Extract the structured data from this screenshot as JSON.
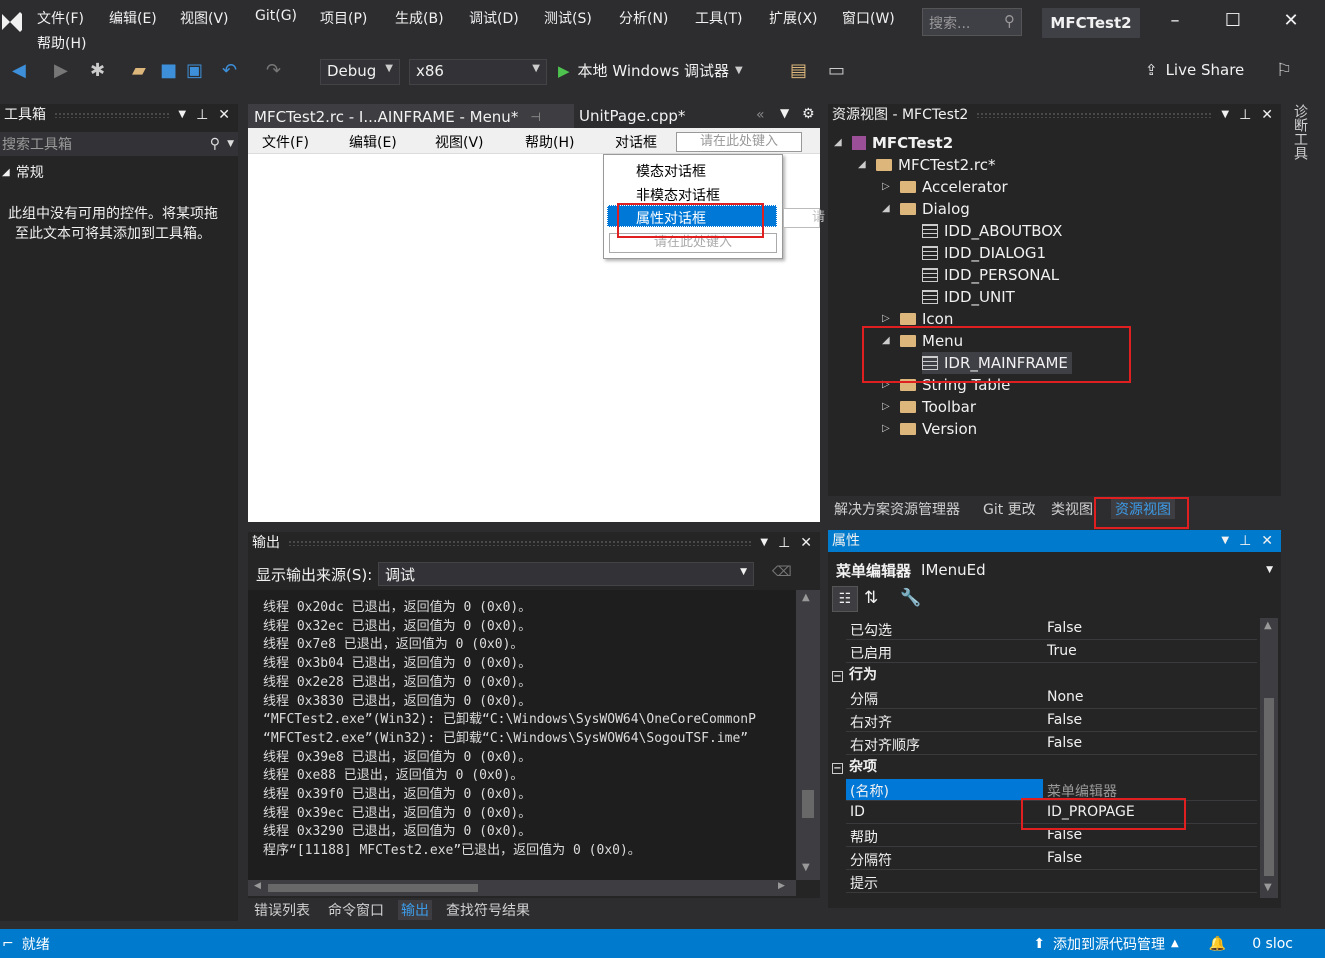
{
  "menu": {
    "items": [
      "文件(F)",
      "编辑(E)",
      "视图(V)",
      "Git(G)",
      "项目(P)",
      "生成(B)",
      "调试(D)",
      "测试(S)",
      "分析(N)",
      "工具(T)",
      "扩展(X)",
      "窗口(W)"
    ],
    "help": "帮助(H)",
    "search_placeholder": "搜索...",
    "solution_name": "MFCTest2"
  },
  "toolbar": {
    "config": "Debug",
    "platform": "x86",
    "debug_target": "本地 Windows 调试器",
    "live_share": "Live Share"
  },
  "side_vertical_tab": "诊断工具",
  "toolbox": {
    "title": "工具箱",
    "search_placeholder": "搜索工具箱",
    "group": "常规",
    "empty_message": "此组中没有可用的控件。将某项拖至此文本可将其添加到工具箱。"
  },
  "editor": {
    "tabs": [
      {
        "label": "MFCTest2.rc - I...AINFRAME - Menu*",
        "active": true
      },
      {
        "label": "UnitPage.cpp*",
        "active": false
      }
    ],
    "menubar": [
      "文件(F)",
      "编辑(E)",
      "视图(V)",
      "帮助(H)",
      "对话框"
    ],
    "type_here": "请在此处键入",
    "dropdown": [
      "模态对话框",
      "非模态对话框",
      "属性对话框"
    ],
    "dropdown_type_here": "请在此处键入",
    "side_type_here": "请"
  },
  "resource_view": {
    "title": "资源视图 - MFCTest2",
    "tree": [
      {
        "label": "MFCTest2",
        "level": 0,
        "bold": true,
        "kind": "project"
      },
      {
        "label": "MFCTest2.rc*",
        "level": 1,
        "kind": "rc"
      },
      {
        "label": "Accelerator",
        "level": 2,
        "kind": "folder",
        "expanded": false
      },
      {
        "label": "Dialog",
        "level": 2,
        "kind": "folder",
        "expanded": true
      },
      {
        "label": "IDD_ABOUTBOX",
        "level": 3,
        "kind": "item"
      },
      {
        "label": "IDD_DIALOG1",
        "level": 3,
        "kind": "item"
      },
      {
        "label": "IDD_PERSONAL",
        "level": 3,
        "kind": "item"
      },
      {
        "label": "IDD_UNIT",
        "level": 3,
        "kind": "item"
      },
      {
        "label": "Icon",
        "level": 2,
        "kind": "folder",
        "expanded": false
      },
      {
        "label": "Menu",
        "level": 2,
        "kind": "folder",
        "expanded": true
      },
      {
        "label": "IDR_MAINFRAME",
        "level": 3,
        "kind": "item",
        "selected": true
      },
      {
        "label": "String Table",
        "level": 2,
        "kind": "folder",
        "expanded": false
      },
      {
        "label": "Toolbar",
        "level": 2,
        "kind": "folder",
        "expanded": false
      },
      {
        "label": "Version",
        "level": 2,
        "kind": "folder",
        "expanded": false
      }
    ],
    "bottom_tabs": [
      "解决方案资源管理器",
      "Git 更改",
      "类视图",
      "资源视图"
    ]
  },
  "output": {
    "title": "输出",
    "source_label": "显示输出来源(S):",
    "source_value": "调试",
    "lines": [
      "线程 0x20dc 已退出，返回值为 0 (0x0)。",
      "线程 0x32ec 已退出，返回值为 0 (0x0)。",
      "线程 0x7e8 已退出，返回值为 0 (0x0)。",
      "线程 0x3b04 已退出，返回值为 0 (0x0)。",
      "线程 0x2e28 已退出，返回值为 0 (0x0)。",
      "线程 0x3830 已退出，返回值为 0 (0x0)。",
      "“MFCTest2.exe”(Win32): 已卸载“C:\\Windows\\SysWOW64\\OneCoreCommonP",
      "“MFCTest2.exe”(Win32): 已卸载“C:\\Windows\\SysWOW64\\SogouTSF.ime”",
      "线程 0x39e8 已退出，返回值为 0 (0x0)。",
      "线程 0xe88 已退出，返回值为 0 (0x0)。",
      "线程 0x39f0 已退出，返回值为 0 (0x0)。",
      "线程 0x39ec 已退出，返回值为 0 (0x0)。",
      "线程 0x3290 已退出，返回值为 0 (0x0)。",
      "程序“[11188] MFCTest2.exe”已退出，返回值为 0 (0x0)。"
    ],
    "bottom_tabs": [
      "错误列表",
      "命令窗口",
      "输出",
      "查找符号结果"
    ]
  },
  "properties": {
    "title": "属性",
    "object": "菜单编辑器",
    "object_type": "IMenuEd",
    "rows": [
      {
        "type": "prop",
        "key": "已勾选",
        "value": "False"
      },
      {
        "type": "prop",
        "key": "已启用",
        "value": "True"
      },
      {
        "type": "cat",
        "key": "行为"
      },
      {
        "type": "prop",
        "key": "分隔",
        "value": "None"
      },
      {
        "type": "prop",
        "key": "右对齐",
        "value": "False"
      },
      {
        "type": "prop",
        "key": "右对齐顺序",
        "value": "False"
      },
      {
        "type": "cat",
        "key": "杂项"
      },
      {
        "type": "prop",
        "key": "(名称)",
        "value": "菜单编辑器",
        "selected": true
      },
      {
        "type": "prop",
        "key": "ID",
        "value": "ID_PROPAGE"
      },
      {
        "type": "prop",
        "key": "帮助",
        "value": "False"
      },
      {
        "type": "prop",
        "key": "分隔符",
        "value": "False"
      },
      {
        "type": "prop",
        "key": "提示",
        "value": ""
      }
    ]
  },
  "status": {
    "ready": "就绪",
    "source_control": "添加到源代码管理",
    "sloc": "0 sloc"
  },
  "colors": {
    "accent": "#007acc",
    "highlight": "#e02020",
    "selection": "#0078d7"
  }
}
